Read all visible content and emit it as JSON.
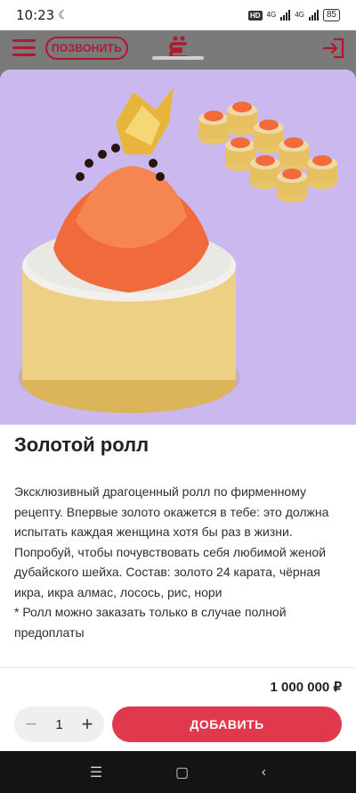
{
  "status": {
    "time": "10:23",
    "battery": "85",
    "network1": "4G",
    "network2": "4G"
  },
  "header": {
    "call_label": "ПОЗВОНИТЬ"
  },
  "product": {
    "title": "Золотой ролл",
    "description_lines": [
      "Эксклюзивный драгоценный ролл по фирменному рецепту. Впервые золото окажется в тебе: это должна испытать каждая женщина хотя бы раз в жизни. Попробуй, чтобы почувствовать себя любимой женой дубайского шейха. Состав: золото 24 карата, чёрная икра, икра алмас, лосось, рис, нори",
      "* Ролл можно заказать только в случае полной предоплаты"
    ],
    "price": "1 000 000 ₽"
  },
  "cart": {
    "quantity": "1",
    "add_label": "ДОБАВИТЬ"
  },
  "colors": {
    "brand": "#b3162f",
    "accent_button": "#e0384d",
    "hero_bg": "#cbb8ee"
  }
}
